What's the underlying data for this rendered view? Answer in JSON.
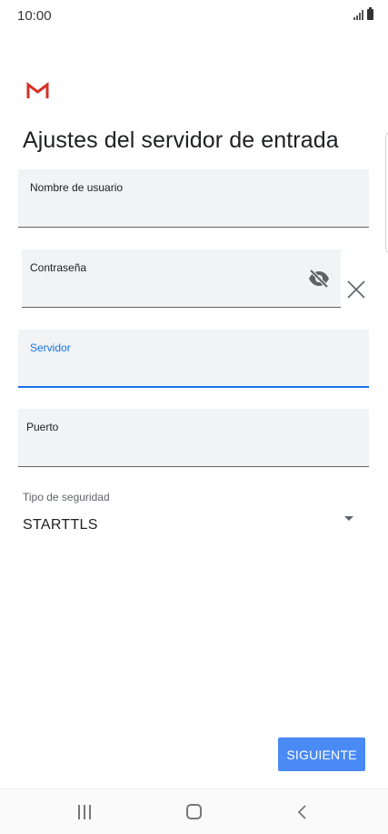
{
  "status_bar": {
    "time": "10:00",
    "icons": [
      "signal-icon",
      "battery-icon"
    ]
  },
  "app": {
    "logo_icon": "gmail-logo-icon",
    "colors": {
      "primary": "#1a73e8",
      "button": "#4a8af4",
      "gmail_red": "#d93025"
    }
  },
  "page": {
    "title": "Ajustes del servidor de entrada"
  },
  "form": {
    "username_label": "Nombre de usuario",
    "username_value": "",
    "password_label": "Contraseña",
    "password_value": "",
    "server_label": "Servidor",
    "server_value": "",
    "port_label": "Puerto",
    "port_value": "",
    "security_label": "Tipo de seguridad",
    "security_value": "STARTTLS"
  },
  "actions": {
    "next_label": "SIGUIENTE"
  },
  "nav_bar": {
    "icons": [
      "recents-icon",
      "home-icon",
      "back-icon"
    ]
  }
}
